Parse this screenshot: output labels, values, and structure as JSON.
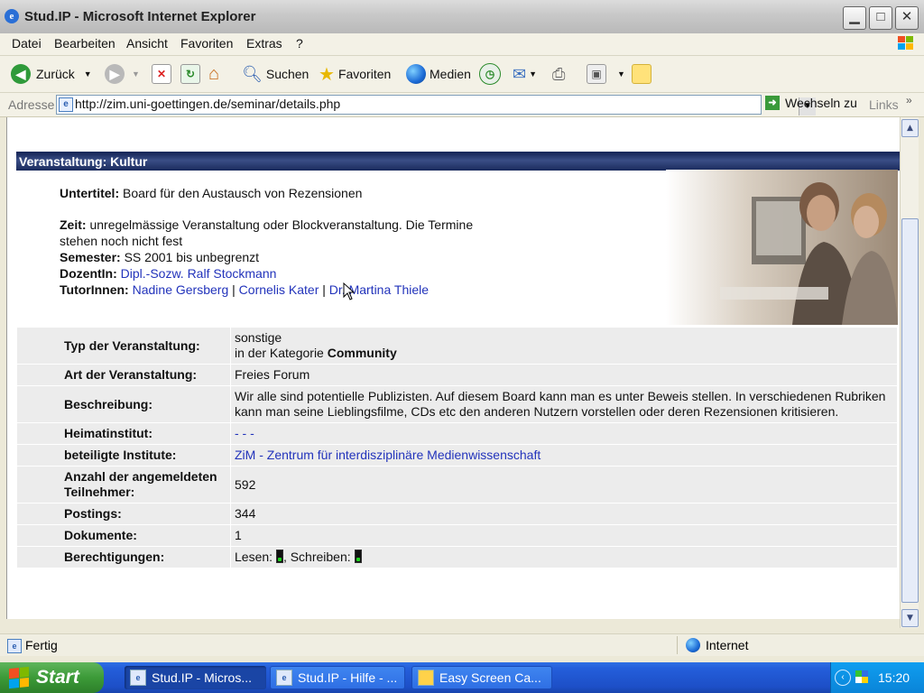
{
  "window": {
    "title": "Stud.IP - Microsoft Internet Explorer",
    "buttons": [
      "_",
      "□",
      "X"
    ]
  },
  "menu": [
    "Datei",
    "Bearbeiten",
    "Ansicht",
    "Favoriten",
    "Extras",
    "?"
  ],
  "toolbar": {
    "back": "Zurück",
    "search": "Suchen",
    "favorites": "Favoriten",
    "media": "Medien"
  },
  "address": {
    "label": "Adresse",
    "url": "http://zim.uni-goettingen.de/seminar/details.php",
    "go": "Wechseln zu",
    "links": "Links"
  },
  "page": {
    "header": "Veranstaltung: Kultur",
    "untertitel_label": "Untertitel:",
    "untertitel_value": "Board für den Austausch von Rezensionen",
    "zeit_label": "Zeit:",
    "zeit_value": "unregelmässige Veranstaltung oder Blockveranstaltung. Die Termine stehen noch nicht fest",
    "semester_label": "Semester:",
    "semester_value": "SS 2001 bis unbegrenzt",
    "dozent_label": "DozentIn:",
    "dozent_value": "Dipl.-Sozw. Ralf Stockmann",
    "tutor_label": "TutorInnen:",
    "tutors": [
      "Nadine Gersberg",
      "Cornelis Kater",
      "Dr. Martina Thiele"
    ],
    "tutor_sep": "|"
  },
  "details": [
    {
      "label": "Typ der Veranstaltung:",
      "line1": "sonstige",
      "line2_prefix": "in der Kategorie ",
      "line2_bold": "Community"
    },
    {
      "label": "Art der Veranstaltung:",
      "value": "Freies Forum"
    },
    {
      "label": "Beschreibung:",
      "value": "Wir alle sind potentielle Publizisten. Auf diesem Board kann man es unter Beweis stellen. In verschiedenen Rubriken kann man seine Lieblingsfilme, CDs etc den anderen Nutzern vorstellen oder deren Rezensionen kritisieren."
    },
    {
      "label": "Heimatinstitut:",
      "link": "- - -"
    },
    {
      "label": "beteiligte Institute:",
      "link": "ZiM - Zentrum für interdisziplinäre Medienwissenschaft"
    },
    {
      "label": "Anzahl der angemeldeten Teilnehmer:",
      "value": "592"
    },
    {
      "label": "Postings:",
      "value": "344"
    },
    {
      "label": "Dokumente:",
      "value": "1"
    },
    {
      "label": "Berechtigungen:",
      "read": "Lesen:",
      "write": ", Schreiben:"
    }
  ],
  "status": {
    "text": "Fertig",
    "zone": "Internet"
  },
  "taskbar": {
    "start": "Start",
    "tasks": [
      "Stud.IP - Micros...",
      "Stud.IP - Hilfe - ...",
      "Easy Screen Ca..."
    ],
    "clock": "15:20"
  },
  "colors": {
    "header_bg": "#1a2a5c",
    "link": "#2233bb",
    "taskbar": "#245edb",
    "start": "#3c9a38"
  }
}
